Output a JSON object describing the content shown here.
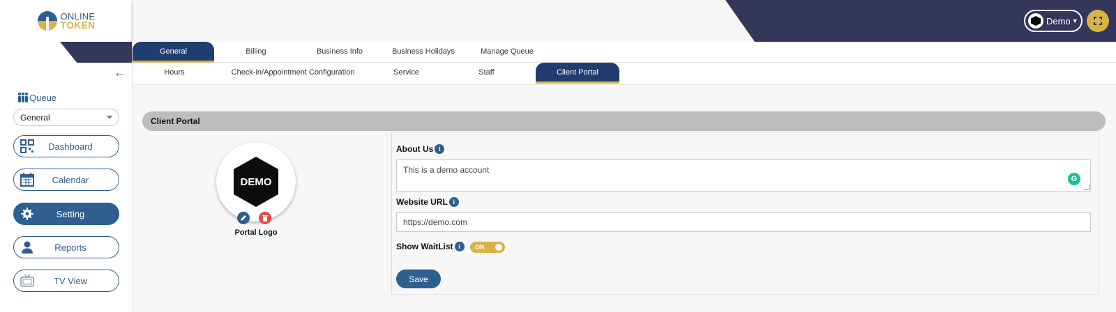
{
  "brand": {
    "line1": "ONLINE",
    "line2": "TOKEN",
    "accent": "#d8b447",
    "primary": "#2e5f8f",
    "dark": "#34365a"
  },
  "header": {
    "account_label": "Demo",
    "fullscreen_icon": "fullscreen-icon"
  },
  "sidebar": {
    "collapse_icon": "arrow-left-icon",
    "queue_label": "Queue",
    "queue_selected": "General",
    "items": [
      {
        "label": "Dashboard",
        "icon": "qr-code-icon",
        "active": false
      },
      {
        "label": "Calendar",
        "icon": "calendar-icon",
        "active": false
      },
      {
        "label": "Setting",
        "icon": "gear-icon",
        "active": true
      },
      {
        "label": "Reports",
        "icon": "user-icon",
        "active": false
      },
      {
        "label": "TV View",
        "icon": "tv-icon",
        "active": false
      }
    ]
  },
  "tabs_primary": [
    "General",
    "Billing",
    "Business Info",
    "Business Holidays",
    "Manage Queue"
  ],
  "tabs_secondary": [
    "Hours",
    "Check-in/Appointment Configuration",
    "Service",
    "Staff",
    "Client Portal"
  ],
  "section": {
    "title": "Client Portal",
    "logo_text": "DEMO",
    "logo_label": "Portal Logo",
    "about_label": "About Us",
    "about_value": "This is a demo account",
    "website_label": "Website URL",
    "website_value": "https://demo.com",
    "waitlist_label": "Show WaitList",
    "waitlist_toggle": "ON",
    "save_label": "Save"
  }
}
